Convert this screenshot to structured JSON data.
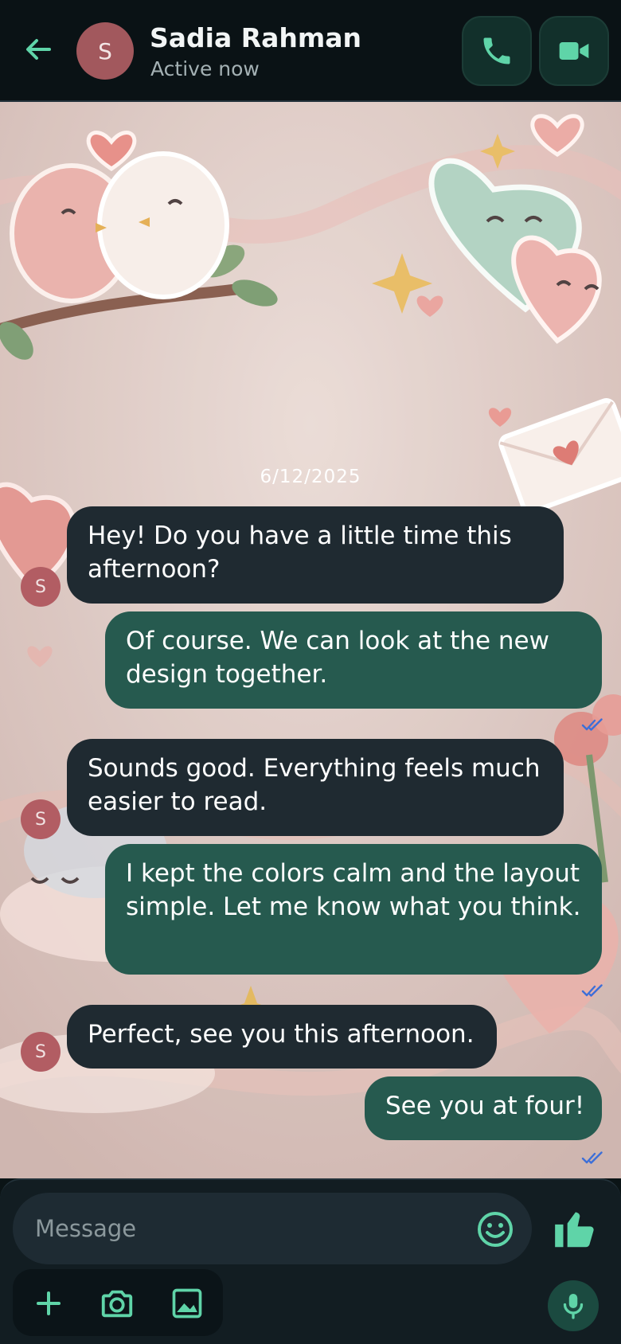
{
  "header": {
    "avatar_initial": "S",
    "contact_name": "Sadia Rahman",
    "status": "Active now"
  },
  "chat": {
    "date": "6/12/2025",
    "messages": [
      {
        "direction": "in",
        "avatar": "S",
        "text": "Hey! Do you have a little time this afternoon?"
      },
      {
        "direction": "out",
        "text": "Of course. We can look at the new design together.",
        "read": true
      },
      {
        "direction": "in",
        "avatar": "S",
        "text": "Sounds good. Everything feels much easier to read."
      },
      {
        "direction": "out",
        "text": "I kept the colors calm and the layout simple. Let me know what you think.",
        "read": true
      },
      {
        "direction": "in",
        "avatar": "S",
        "text": "Perfect, see you this afternoon."
      },
      {
        "direction": "out",
        "text": "See you at four!",
        "read": true
      }
    ]
  },
  "composer": {
    "placeholder": "Message"
  },
  "icons": {
    "back": "arrow-left-icon",
    "call": "phone-icon",
    "video": "video-camera-icon",
    "emoji": "smiley-icon",
    "like": "thumbs-up-icon",
    "add": "plus-icon",
    "camera": "camera-icon",
    "gallery": "image-icon",
    "mic": "microphone-icon",
    "read": "double-check-icon"
  },
  "colors": {
    "accent": "#5fd4a8",
    "incoming_bubble": "#1f2a31",
    "outgoing_bubble": "#265a4f",
    "avatar": "#a2585d",
    "read_tick": "#3d6fd8"
  }
}
